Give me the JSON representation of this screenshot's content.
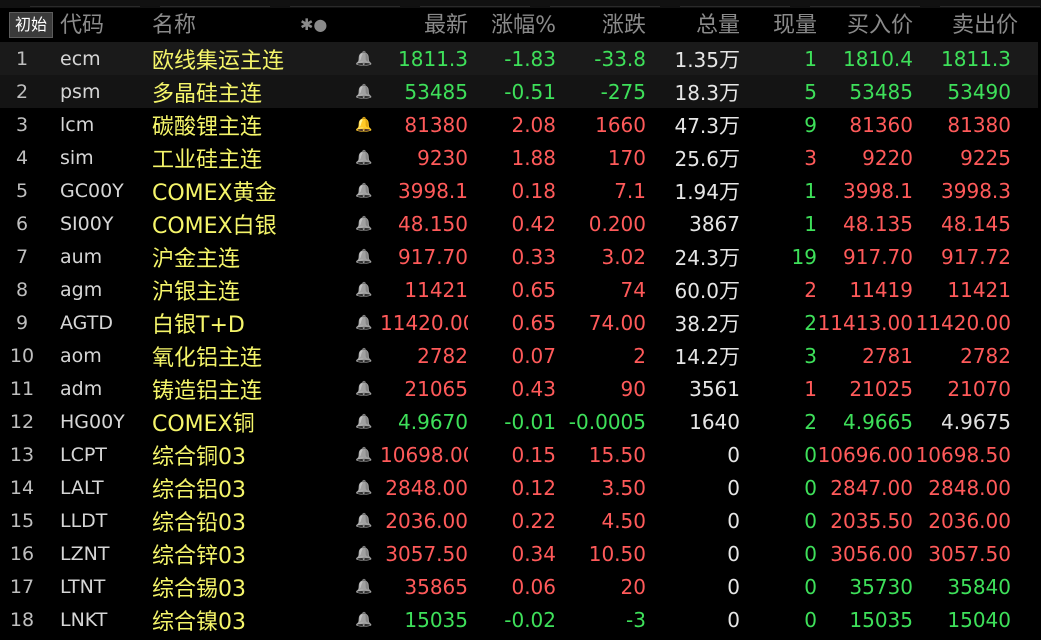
{
  "header": {
    "reset_label": "初始",
    "columns": [
      "代码",
      "名称",
      "最新",
      "涨幅%",
      "涨跌",
      "总量",
      "现量",
      "买入价",
      "卖出价"
    ],
    "toggle_icons": "✱●"
  },
  "colors": {
    "up": "#ff5a5a",
    "down": "#3ee05a",
    "name": "#f5f56a",
    "bell_on": "#ff4a2a"
  },
  "rows": [
    {
      "idx": "1",
      "code": "ecm",
      "name": "欧线集运主连",
      "bell": "off",
      "last": "1811.3",
      "pct": "-1.83",
      "chg": "-33.8",
      "vol": "1.35",
      "unit": "万",
      "cur": "1",
      "bid": "1810.4",
      "ask": "1811.3",
      "dir": "dn",
      "cur_dir": "dn",
      "bid_dir": "dn",
      "ask_dir": "dn",
      "sel": "sel"
    },
    {
      "idx": "2",
      "code": "psm",
      "name": "多晶硅主连",
      "bell": "off",
      "last": "53485",
      "pct": "-0.51",
      "chg": "-275",
      "vol": "18.3",
      "unit": "万",
      "cur": "5",
      "bid": "53485",
      "ask": "53490",
      "dir": "dn",
      "cur_dir": "dn",
      "bid_dir": "dn",
      "ask_dir": "dn",
      "sel": "sel2"
    },
    {
      "idx": "3",
      "code": "lcm",
      "name": "碳酸锂主连",
      "bell": "on",
      "last": "81380",
      "pct": "2.08",
      "chg": "1660",
      "vol": "47.3",
      "unit": "万",
      "cur": "9",
      "bid": "81360",
      "ask": "81380",
      "dir": "up",
      "cur_dir": "dn",
      "bid_dir": "up",
      "ask_dir": "up",
      "sel": ""
    },
    {
      "idx": "4",
      "code": "sim",
      "name": "工业硅主连",
      "bell": "off",
      "last": "9230",
      "pct": "1.88",
      "chg": "170",
      "vol": "25.6",
      "unit": "万",
      "cur": "3",
      "bid": "9220",
      "ask": "9225",
      "dir": "up",
      "cur_dir": "up",
      "bid_dir": "up",
      "ask_dir": "up",
      "sel": ""
    },
    {
      "idx": "5",
      "code": "GC00Y",
      "name": "COMEX黄金",
      "bell": "off",
      "last": "3998.1",
      "pct": "0.18",
      "chg": "7.1",
      "vol": "1.94",
      "unit": "万",
      "cur": "1",
      "bid": "3998.1",
      "ask": "3998.3",
      "dir": "up",
      "cur_dir": "dn",
      "bid_dir": "up",
      "ask_dir": "up",
      "sel": ""
    },
    {
      "idx": "6",
      "code": "SI00Y",
      "name": "COMEX白银",
      "bell": "off",
      "last": "48.150",
      "pct": "0.42",
      "chg": "0.200",
      "vol": "3867",
      "unit": "",
      "cur": "1",
      "bid": "48.135",
      "ask": "48.145",
      "dir": "up",
      "cur_dir": "dn",
      "bid_dir": "up",
      "ask_dir": "up",
      "sel": ""
    },
    {
      "idx": "7",
      "code": "aum",
      "name": "沪金主连",
      "bell": "off",
      "last": "917.70",
      "pct": "0.33",
      "chg": "3.02",
      "vol": "24.3",
      "unit": "万",
      "cur": "19",
      "bid": "917.70",
      "ask": "917.72",
      "dir": "up",
      "cur_dir": "dn",
      "bid_dir": "up",
      "ask_dir": "up",
      "sel": ""
    },
    {
      "idx": "8",
      "code": "agm",
      "name": "沪银主连",
      "bell": "off",
      "last": "11421",
      "pct": "0.65",
      "chg": "74",
      "vol": "60.0",
      "unit": "万",
      "cur": "2",
      "bid": "11419",
      "ask": "11421",
      "dir": "up",
      "cur_dir": "up",
      "bid_dir": "up",
      "ask_dir": "up",
      "sel": ""
    },
    {
      "idx": "9",
      "code": "AGTD",
      "name": "白银T+D",
      "bell": "off",
      "last": "11420.00",
      "pct": "0.65",
      "chg": "74.00",
      "vol": "38.2",
      "unit": "万",
      "cur": "2",
      "bid": "11413.00",
      "ask": "11420.00",
      "dir": "up",
      "cur_dir": "dn",
      "bid_dir": "up",
      "ask_dir": "up",
      "sel": ""
    },
    {
      "idx": "10",
      "code": "aom",
      "name": "氧化铝主连",
      "bell": "off",
      "last": "2782",
      "pct": "0.07",
      "chg": "2",
      "vol": "14.2",
      "unit": "万",
      "cur": "3",
      "bid": "2781",
      "ask": "2782",
      "dir": "up",
      "cur_dir": "dn",
      "bid_dir": "up",
      "ask_dir": "up",
      "sel": ""
    },
    {
      "idx": "11",
      "code": "adm",
      "name": "铸造铝主连",
      "bell": "off",
      "last": "21065",
      "pct": "0.43",
      "chg": "90",
      "vol": "3561",
      "unit": "",
      "cur": "1",
      "bid": "21025",
      "ask": "21070",
      "dir": "up",
      "cur_dir": "up",
      "bid_dir": "up",
      "ask_dir": "up",
      "sel": ""
    },
    {
      "idx": "12",
      "code": "HG00Y",
      "name": "COMEX铜",
      "bell": "off",
      "last": "4.9670",
      "pct": "-0.01",
      "chg": "-0.0005",
      "vol": "1640",
      "unit": "",
      "cur": "2",
      "bid": "4.9665",
      "ask": "4.9675",
      "dir": "dn",
      "cur_dir": "dn",
      "bid_dir": "dn",
      "ask_dir": "wh",
      "sel": ""
    },
    {
      "idx": "13",
      "code": "LCPT",
      "name": "综合铜03",
      "bell": "off",
      "last": "10698.00",
      "pct": "0.15",
      "chg": "15.50",
      "vol": "0",
      "unit": "",
      "cur": "0",
      "bid": "10696.00",
      "ask": "10698.50",
      "dir": "up",
      "cur_dir": "dn",
      "bid_dir": "up",
      "ask_dir": "up",
      "sel": ""
    },
    {
      "idx": "14",
      "code": "LALT",
      "name": "综合铝03",
      "bell": "off",
      "last": "2848.00",
      "pct": "0.12",
      "chg": "3.50",
      "vol": "0",
      "unit": "",
      "cur": "0",
      "bid": "2847.00",
      "ask": "2848.00",
      "dir": "up",
      "cur_dir": "dn",
      "bid_dir": "up",
      "ask_dir": "up",
      "sel": ""
    },
    {
      "idx": "15",
      "code": "LLDT",
      "name": "综合铅03",
      "bell": "off",
      "last": "2036.00",
      "pct": "0.22",
      "chg": "4.50",
      "vol": "0",
      "unit": "",
      "cur": "0",
      "bid": "2035.50",
      "ask": "2036.00",
      "dir": "up",
      "cur_dir": "dn",
      "bid_dir": "up",
      "ask_dir": "up",
      "sel": ""
    },
    {
      "idx": "16",
      "code": "LZNT",
      "name": "综合锌03",
      "bell": "off",
      "last": "3057.50",
      "pct": "0.34",
      "chg": "10.50",
      "vol": "0",
      "unit": "",
      "cur": "0",
      "bid": "3056.00",
      "ask": "3057.50",
      "dir": "up",
      "cur_dir": "dn",
      "bid_dir": "up",
      "ask_dir": "up",
      "sel": ""
    },
    {
      "idx": "17",
      "code": "LTNT",
      "name": "综合锡03",
      "bell": "off",
      "last": "35865",
      "pct": "0.06",
      "chg": "20",
      "vol": "0",
      "unit": "",
      "cur": "0",
      "bid": "35730",
      "ask": "35840",
      "dir": "up",
      "cur_dir": "dn",
      "bid_dir": "dn",
      "ask_dir": "dn",
      "sel": ""
    },
    {
      "idx": "18",
      "code": "LNKT",
      "name": "综合镍03",
      "bell": "off",
      "last": "15035",
      "pct": "-0.02",
      "chg": "-3",
      "vol": "0",
      "unit": "",
      "cur": "0",
      "bid": "15035",
      "ask": "15040",
      "dir": "dn",
      "cur_dir": "dn",
      "bid_dir": "dn",
      "ask_dir": "dn",
      "sel": ""
    }
  ]
}
